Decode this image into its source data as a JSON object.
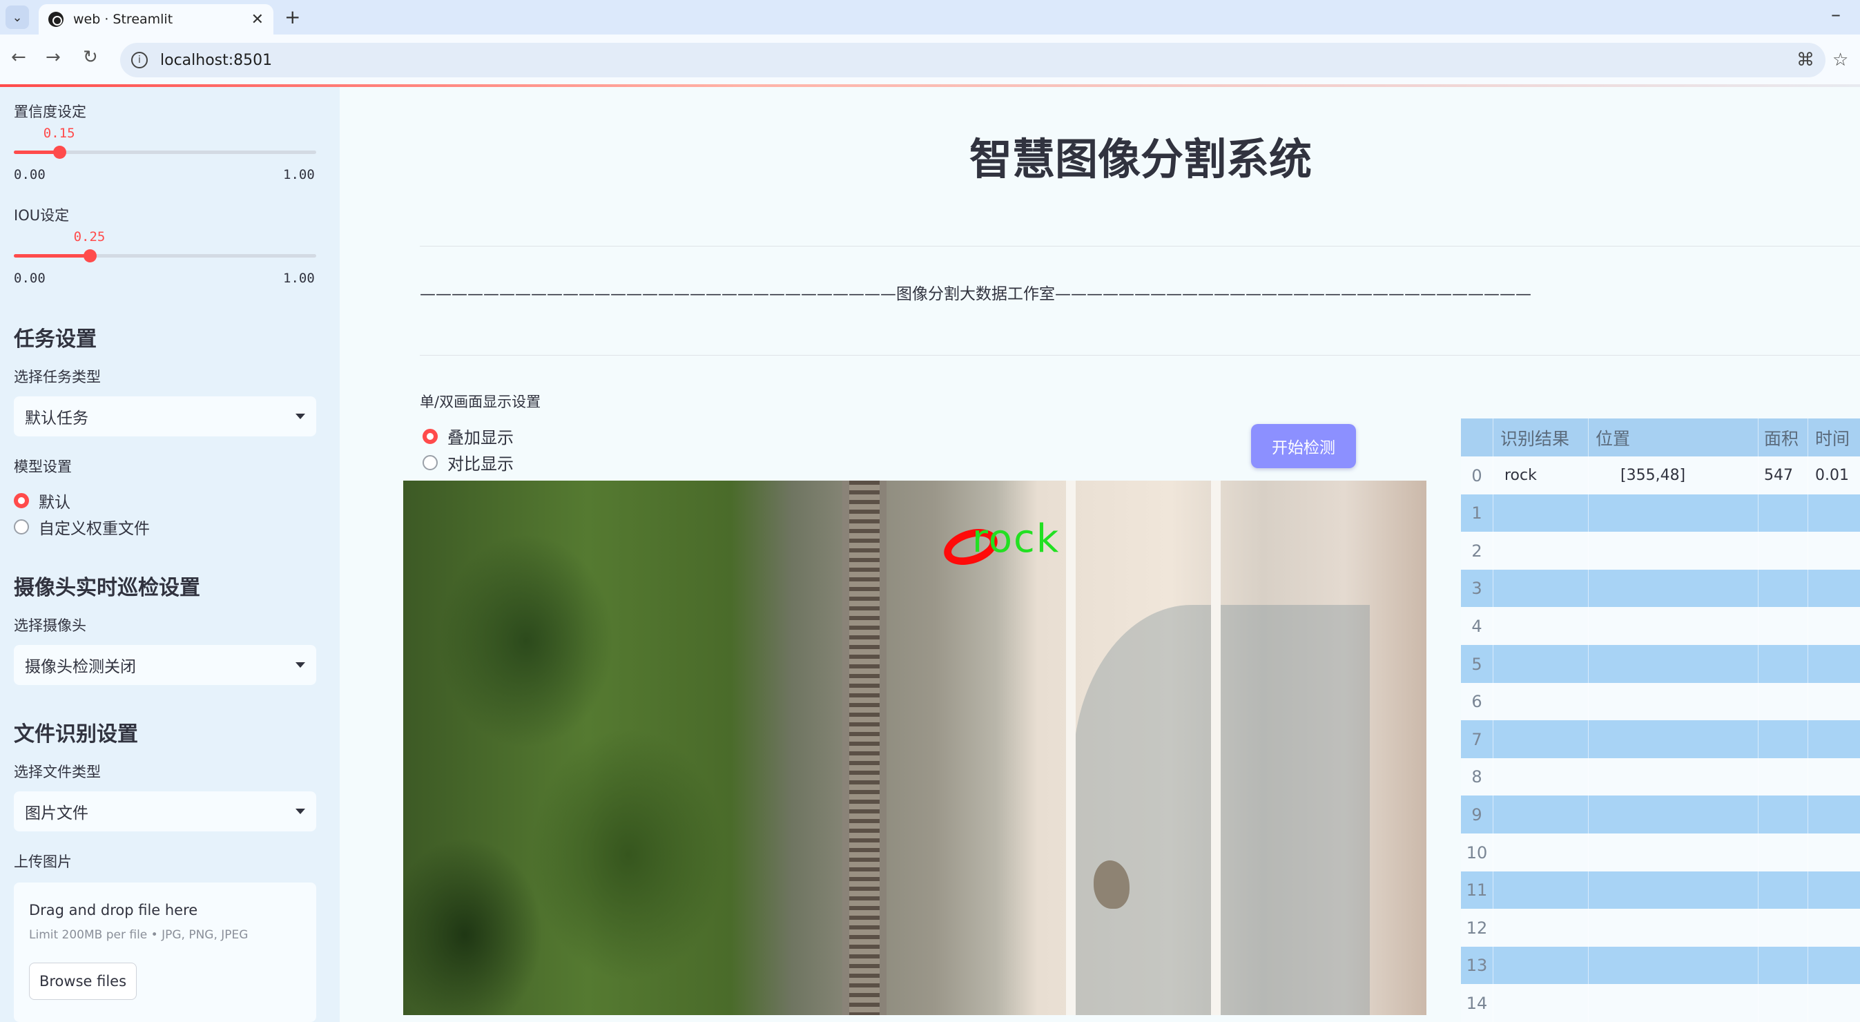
{
  "browser": {
    "tab_title": "web · Streamlit",
    "url": "localhost:8501"
  },
  "sidebar": {
    "confidence": {
      "label": "置信度设定",
      "value": "0.15",
      "min": "0.00",
      "max": "1.00",
      "fraction": 0.15
    },
    "iou": {
      "label": "IOU设定",
      "value": "0.25",
      "min": "0.00",
      "max": "1.00",
      "fraction": 0.25
    },
    "task_heading": "任务设置",
    "task_type_label": "选择任务类型",
    "task_type_value": "默认任务",
    "model_label": "模型设置",
    "model_options": [
      "默认",
      "自定义权重文件"
    ],
    "model_selected": 0,
    "camera_heading": "摄像头实时巡检设置",
    "camera_label": "选择摄像头",
    "camera_value": "摄像头检测关闭",
    "file_heading": "文件识别设置",
    "file_type_label": "选择文件类型",
    "file_type_value": "图片文件",
    "upload_label": "上传图片",
    "dropzone_title": "Drag and drop file here",
    "dropzone_limit": "Limit 200MB per file • JPG, PNG, JPEG",
    "browse_label": "Browse files"
  },
  "main": {
    "title": "智慧图像分割系统",
    "banner": "——————————————————————————————图像分割大数据工作室——————————————————————————————",
    "display_label": "单/双画面显示设置",
    "display_options": [
      "叠加显示",
      "对比显示"
    ],
    "display_selected": 0,
    "detect_button": "开始检测",
    "detection_label": "rock"
  },
  "results_table": {
    "columns": [
      "",
      "识别结果",
      "位置",
      "面积",
      "时间"
    ],
    "rows": [
      {
        "index": "0",
        "result": "rock",
        "position": "[355,48]",
        "area": "547",
        "time": "0.01"
      },
      {
        "index": "1"
      },
      {
        "index": "2"
      },
      {
        "index": "3"
      },
      {
        "index": "4"
      },
      {
        "index": "5"
      },
      {
        "index": "6"
      },
      {
        "index": "7"
      },
      {
        "index": "8"
      },
      {
        "index": "9"
      },
      {
        "index": "10"
      },
      {
        "index": "11"
      },
      {
        "index": "12"
      },
      {
        "index": "13"
      },
      {
        "index": "14"
      }
    ]
  },
  "colors": {
    "accent": "#ff4b4b",
    "button": "#8c90ff",
    "table_stripe": "#a8d3f5"
  }
}
